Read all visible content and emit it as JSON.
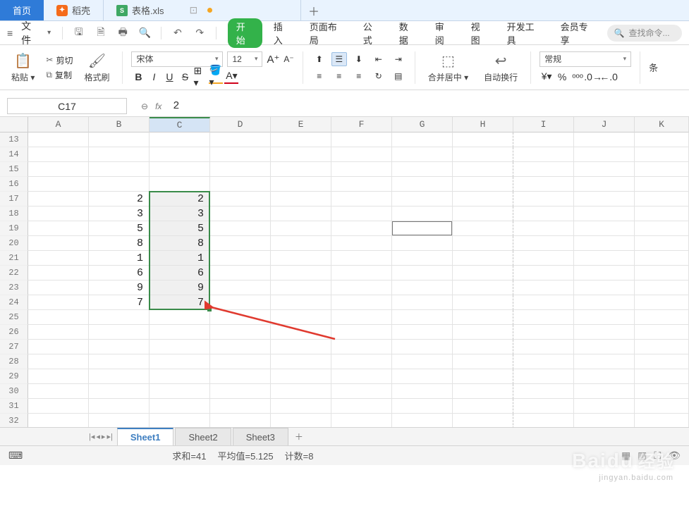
{
  "topbar": {
    "home": "首页",
    "docker": "稻壳",
    "file": "表格.xls"
  },
  "menu": {
    "file": "文件",
    "start_pill": "开始",
    "items": [
      "插入",
      "页面布局",
      "公式",
      "数据",
      "审阅",
      "视图",
      "开发工具",
      "会员专享"
    ],
    "search_ph": "查找命令..."
  },
  "ribbon": {
    "paste": "粘贴",
    "cut": "剪切",
    "copy": "复制",
    "fmt": "格式刷",
    "font_name": "宋体",
    "font_size": "12",
    "merge": "合并居中",
    "wrap": "自动换行",
    "numfmt": "常规",
    "cond": "条"
  },
  "fx": {
    "cell_ref": "C17",
    "formula": "2"
  },
  "grid": {
    "cols": [
      "A",
      "B",
      "C",
      "D",
      "E",
      "F",
      "G",
      "H",
      "I",
      "J",
      "K"
    ],
    "rows": [
      13,
      14,
      15,
      16,
      17,
      18,
      19,
      20,
      21,
      22,
      23,
      24,
      25,
      26,
      27,
      28,
      29,
      30,
      31,
      32
    ],
    "col_b": {
      "17": "2",
      "18": "3",
      "19": "5",
      "20": "8",
      "21": "1",
      "22": "6",
      "23": "9",
      "24": "7"
    },
    "col_c": {
      "17": "2",
      "18": "3",
      "19": "5",
      "20": "8",
      "21": "1",
      "22": "6",
      "23": "9",
      "24": "7"
    },
    "sel_col": "C",
    "sel_row_start": 17,
    "sel_row_end": 24
  },
  "sheets": {
    "tabs": [
      "Sheet1",
      "Sheet2",
      "Sheet3"
    ],
    "active": 0
  },
  "status": {
    "sum_lbl": "求和=",
    "sum_val": "41",
    "avg_lbl": "平均值=",
    "avg_val": "5.125",
    "cnt_lbl": "计数=",
    "cnt_val": "8"
  },
  "watermark": {
    "main": "Baidu",
    "sub": "经验",
    "url": "jingyan.baidu.com"
  }
}
